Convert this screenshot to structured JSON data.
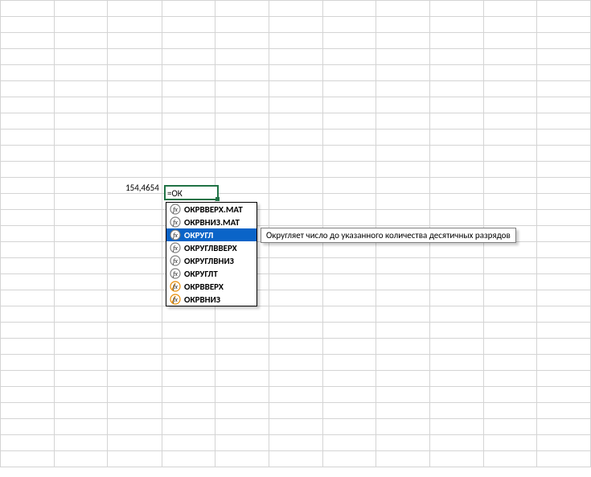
{
  "cells": {
    "left_value": "154,4654",
    "active_formula": "=ОК"
  },
  "autocomplete": {
    "items": [
      {
        "label": "ОКРВВЕРХ.МАТ",
        "icon": "fx",
        "selected": false
      },
      {
        "label": "ОКРВНИЗ.МАТ",
        "icon": "fx",
        "selected": false
      },
      {
        "label": "ОКРУГЛ",
        "icon": "fx",
        "selected": true
      },
      {
        "label": "ОКРУГЛВВЕРХ",
        "icon": "fx",
        "selected": false
      },
      {
        "label": "ОКРУГЛВНИЗ",
        "icon": "fx",
        "selected": false
      },
      {
        "label": "ОКРУГЛТ",
        "icon": "fx",
        "selected": false
      },
      {
        "label": "ОКРВВЕРХ",
        "icon": "fx-orange",
        "selected": false
      },
      {
        "label": "ОКРВНИЗ",
        "icon": "fx-orange",
        "selected": false
      }
    ]
  },
  "tooltip": "Округляет число до указанного количества десятичных разрядов"
}
